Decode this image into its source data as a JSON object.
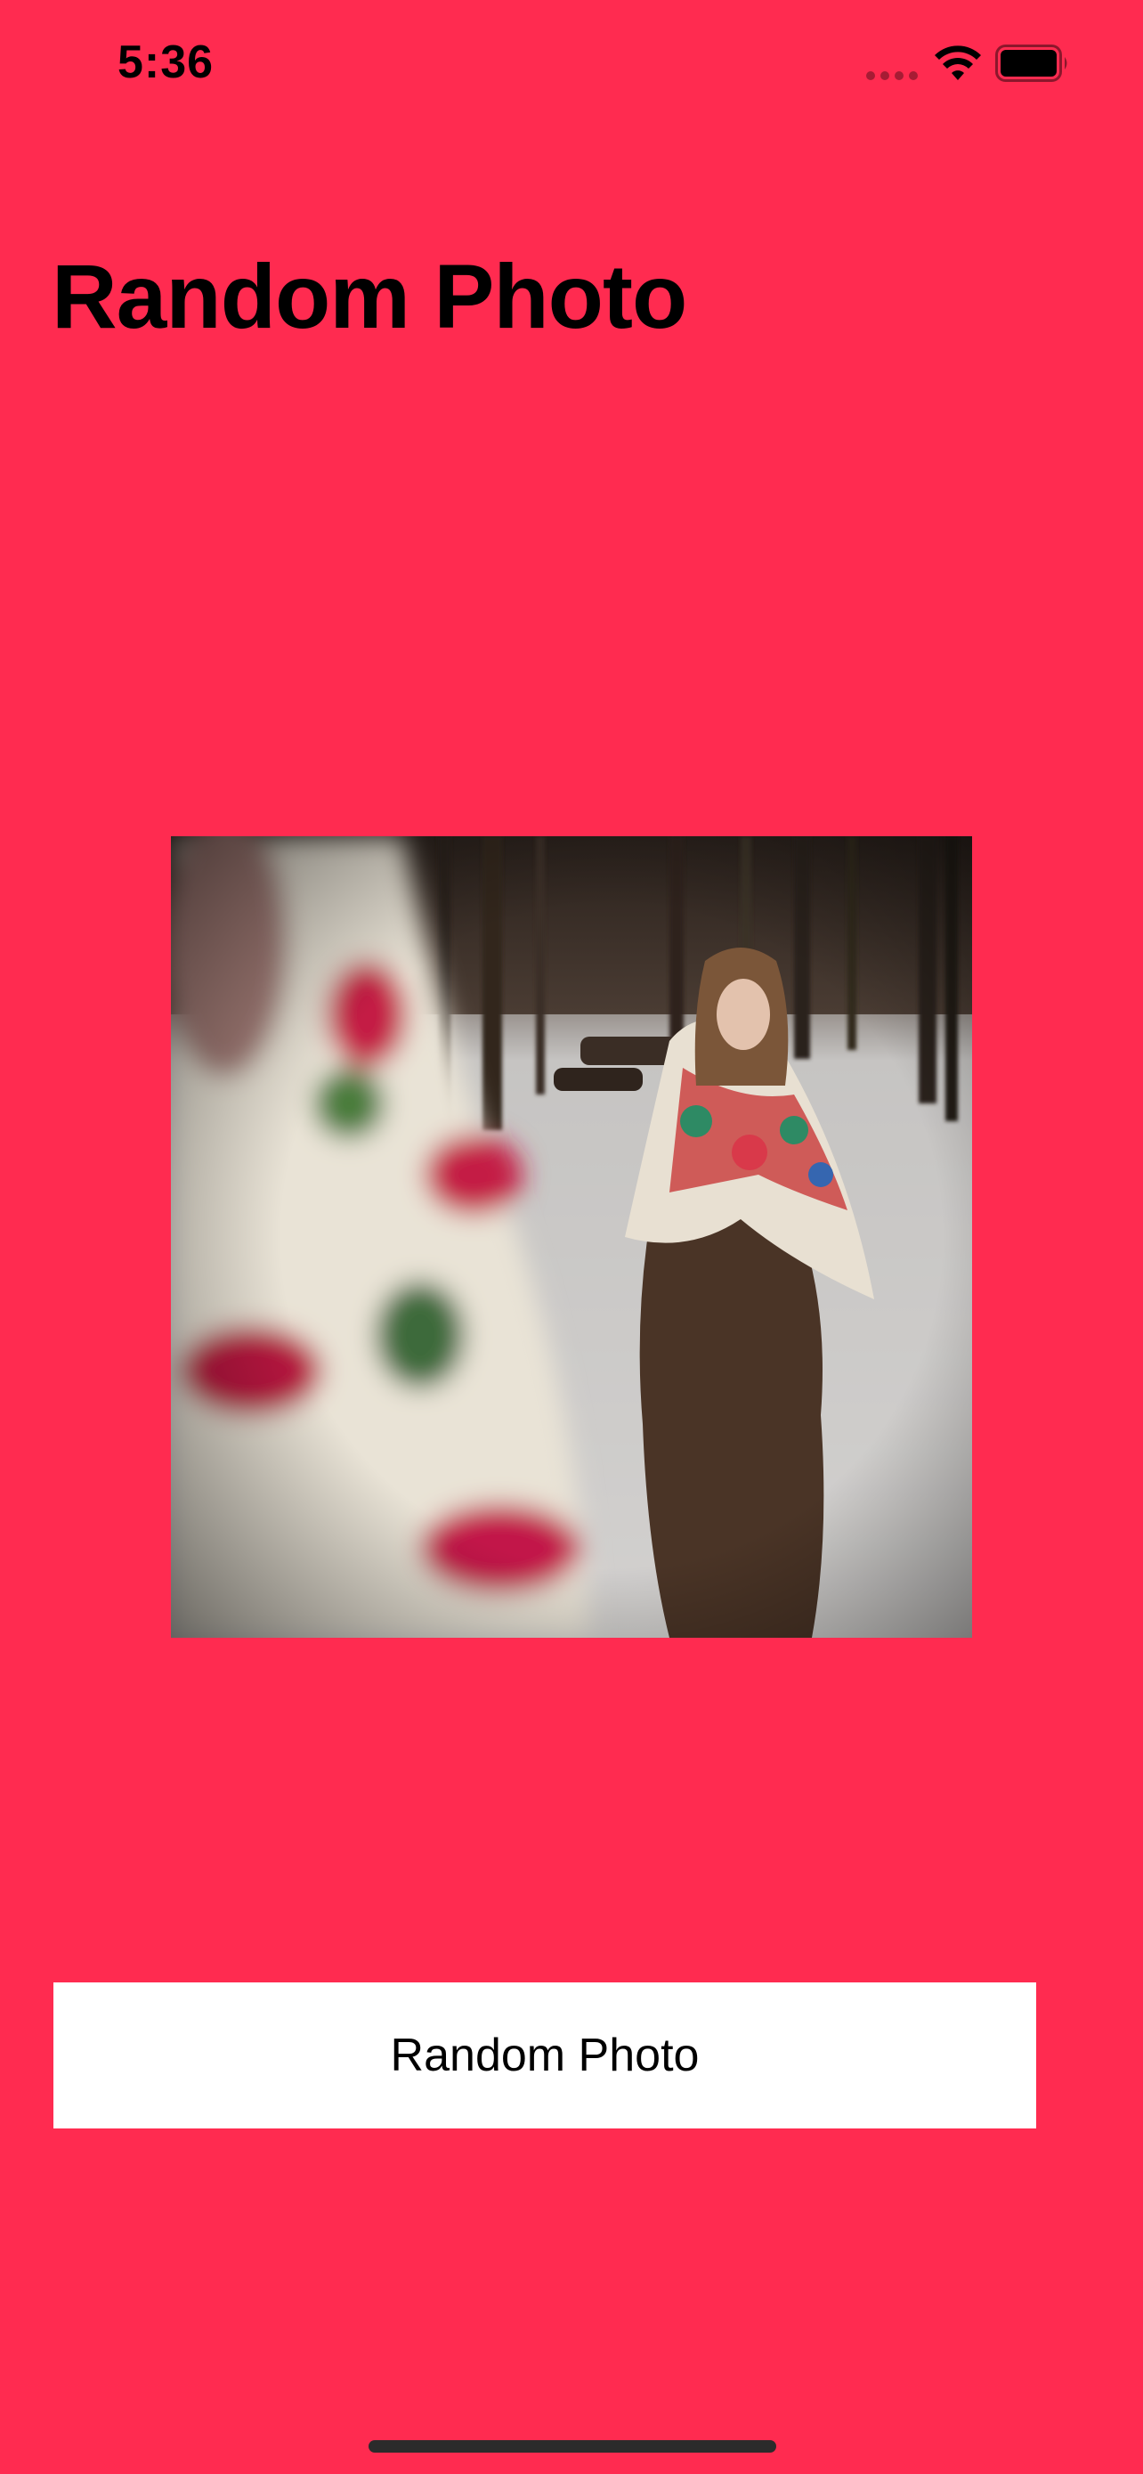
{
  "status_bar": {
    "time": "5:36",
    "icons": [
      "signal-icon",
      "wifi-icon",
      "battery-icon"
    ]
  },
  "nav": {
    "title": "Random Photo"
  },
  "photo": {
    "description_icon": "photo-image"
  },
  "button": {
    "label": "Random Photo"
  },
  "colors": {
    "background": "#FF2B50",
    "button_bg": "#FFFFFF",
    "text": "#000000"
  }
}
